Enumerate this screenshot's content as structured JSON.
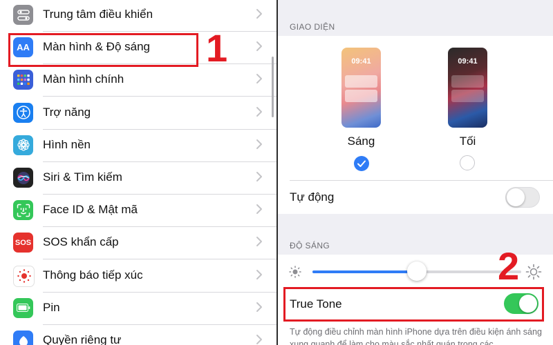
{
  "left": {
    "items": [
      {
        "label": "Trung tâm điều khiển",
        "icon": "control-center-icon",
        "color": "#8e8e93"
      },
      {
        "label": "Màn hình & Độ sáng",
        "icon": "display-brightness-icon",
        "color": "#2f7cf6",
        "glyph": "AA"
      },
      {
        "label": "Màn hình chính",
        "icon": "home-screen-icon",
        "color": "#3a5fd8"
      },
      {
        "label": "Trợ năng",
        "icon": "accessibility-icon",
        "color": "#1a7ff0"
      },
      {
        "label": "Hình nền",
        "icon": "wallpaper-icon",
        "color": "#35aadc"
      },
      {
        "label": "Siri & Tìm kiếm",
        "icon": "siri-icon",
        "color": "#222"
      },
      {
        "label": "Face ID & Mật mã",
        "icon": "face-id-icon",
        "color": "#34c759"
      },
      {
        "label": "SOS khẩn cấp",
        "icon": "sos-icon",
        "color": "#e5322d",
        "glyph": "SOS"
      },
      {
        "label": "Thông báo tiếp xúc",
        "icon": "exposure-notification-icon",
        "color": "#fff"
      },
      {
        "label": "Pin",
        "icon": "battery-icon",
        "color": "#34c759"
      },
      {
        "label": "Quyền riêng tư",
        "icon": "privacy-icon",
        "color": "#2f7cf6"
      }
    ],
    "step_number": "1"
  },
  "right": {
    "appearance_header": "GIAO DIỆN",
    "light": {
      "time": "09:41",
      "label": "Sáng",
      "selected": true
    },
    "dark": {
      "time": "09:41",
      "label": "Tối",
      "selected": false
    },
    "auto": {
      "label": "Tự động",
      "on": false
    },
    "brightness_header": "ĐỘ SÁNG",
    "brightness_level": 0.5,
    "true_tone": {
      "label": "True Tone",
      "on": true
    },
    "footer": "Tự động điều chỉnh màn hình iPhone dựa trên điều kiện ánh sáng xung quanh để làm cho màu sắc nhất quán trong các",
    "step_number": "2"
  },
  "colors": {
    "accent": "#2f7cf6",
    "highlight": "#e31b23",
    "toggle_on": "#34c759"
  }
}
